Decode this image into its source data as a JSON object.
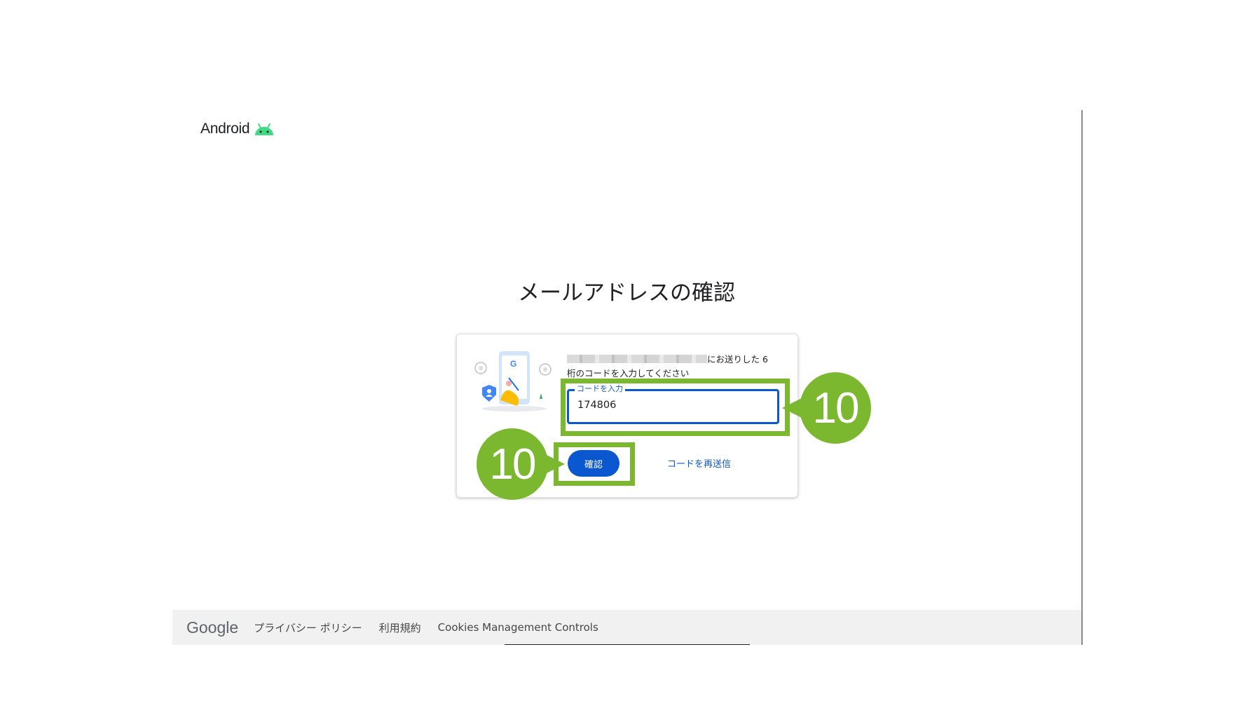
{
  "header": {
    "logo_text": "Android",
    "logo_icon": "android-robot-icon",
    "logo_color": "#3ddc84"
  },
  "main": {
    "title": "メールアドレスの確認",
    "instruction": {
      "email": "",
      "line1_suffix": "にお送りした 6",
      "line2": "桁のコードを入力してください"
    },
    "code_field": {
      "label": "コードを入力",
      "value": "174806"
    },
    "verify_button": "確認",
    "resend_link": "コードを再送信"
  },
  "annotations": {
    "field_step": "10",
    "button_step": "10",
    "highlight_color": "#7cb82f"
  },
  "footer": {
    "logo": "Google",
    "links": [
      "プライバシー ポリシー",
      "利用規約",
      "Cookies Management Controls"
    ]
  },
  "colors": {
    "primary": "#0b57d0",
    "text": "#202124"
  }
}
